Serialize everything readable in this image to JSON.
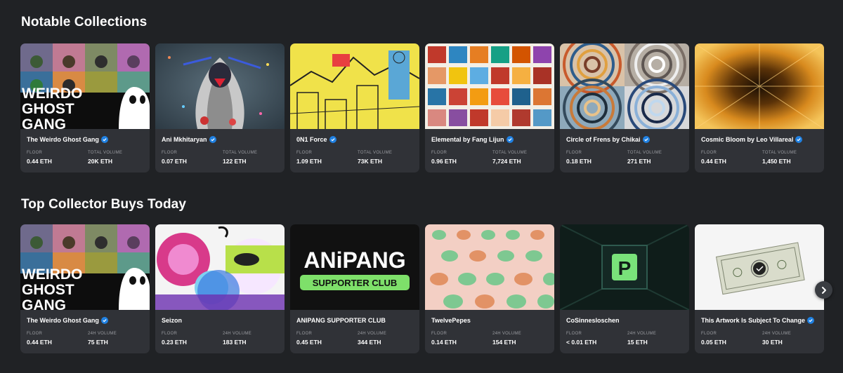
{
  "sections": [
    {
      "title": "Notable Collections",
      "cards": [
        {
          "name": "The Weirdo Ghost Gang",
          "floor_label": "FLOOR",
          "floor": "0.44 ETH",
          "volume_label": "TOTAL VOLUME",
          "volume": "20K ETH",
          "art_text": [
            "WEIRDO",
            "GHOST",
            "GANG"
          ]
        },
        {
          "name": "Ani Mkhitaryan",
          "floor_label": "FLOOR",
          "floor": "0.07 ETH",
          "volume_label": "TOTAL VOLUME",
          "volume": "122 ETH"
        },
        {
          "name": "0N1 Force",
          "floor_label": "FLOOR",
          "floor": "1.09 ETH",
          "volume_label": "TOTAL VOLUME",
          "volume": "73K ETH"
        },
        {
          "name": "Elemental by Fang Lijun",
          "floor_label": "FLOOR",
          "floor": "0.96 ETH",
          "volume_label": "TOTAL VOLUME",
          "volume": "7,724 ETH"
        },
        {
          "name": "Circle of Frens by Chikai",
          "floor_label": "FLOOR",
          "floor": "0.18 ETH",
          "volume_label": "TOTAL VOLUME",
          "volume": "271 ETH"
        },
        {
          "name": "Cosmic Bloom by Leo Villareal",
          "floor_label": "FLOOR",
          "floor": "0.44 ETH",
          "volume_label": "TOTAL VOLUME",
          "volume": "1,450 ETH"
        }
      ]
    },
    {
      "title": "Top Collector Buys Today",
      "cards": [
        {
          "name": "The Weirdo Ghost Gang",
          "floor_label": "FLOOR",
          "floor": "0.44 ETH",
          "volume_label": "24H VOLUME",
          "volume": "75 ETH",
          "art_text": [
            "WEIRDO",
            "GHOST",
            "GANG"
          ]
        },
        {
          "name": "Seizon",
          "floor_label": "FLOOR",
          "floor": "0.23 ETH",
          "volume_label": "24H VOLUME",
          "volume": "183 ETH"
        },
        {
          "name": "ANIPANG SUPPORTER CLUB",
          "floor_label": "FLOOR",
          "floor": "0.45 ETH",
          "volume_label": "24H VOLUME",
          "volume": "344 ETH",
          "art_text": [
            "ANiPANG",
            "SUPPORTER CLUB"
          ]
        },
        {
          "name": "TwelvePepes",
          "floor_label": "FLOOR",
          "floor": "0.14 ETH",
          "volume_label": "24H VOLUME",
          "volume": "154 ETH"
        },
        {
          "name": "CoSinnesloschen",
          "floor_label": "FLOOR",
          "floor": "< 0.01 ETH",
          "volume_label": "24H VOLUME",
          "volume": "15 ETH",
          "art_text": [
            "P"
          ]
        },
        {
          "name": "This Artwork Is Subject To Change",
          "floor_label": "FLOOR",
          "floor": "0.05 ETH",
          "volume_label": "24H VOLUME",
          "volume": "30 ETH"
        }
      ]
    }
  ],
  "icons": {
    "verified": "verified-badge-icon",
    "next": "chevron-right-icon"
  },
  "colors": {
    "background": "#202225",
    "card": "#303237",
    "verified": "#2081e2",
    "muted": "#9a9ca1"
  }
}
